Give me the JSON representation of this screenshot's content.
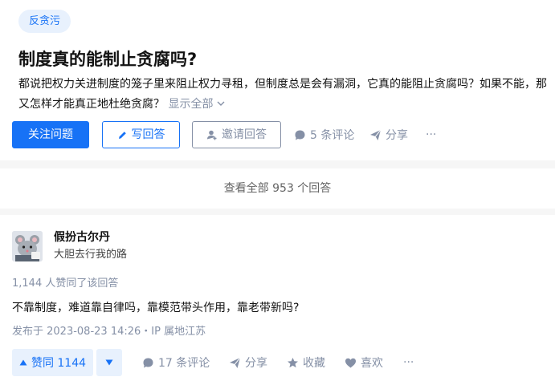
{
  "question": {
    "topic_tag": "反贪污",
    "title": "制度真的能制止贪腐吗?",
    "detail": "都说把权力关进制度的笼子里来阻止权力寻租，但制度总是会有漏洞，它真的能阻止贪腐吗？如果不能，那又怎样才能真正地杜绝贪腐？",
    "show_all": "显示全部",
    "actions": {
      "follow": "关注问题",
      "write_answer": "写回答",
      "invite": "邀请回答",
      "comments": "5 条评论",
      "share": "分享",
      "more": "···"
    }
  },
  "view_all_answers": "查看全部 953 个回答",
  "answer": {
    "author_name": "假扮古尔丹",
    "author_bio": "大胆去行我的路",
    "vote_summary": "1,144 人赞同了该回答",
    "content": "不靠制度，难道靠自律吗，靠模范带头作用，靠老带新吗?",
    "publish_info": "发布于 2023-08-23 14:26・IP 属地江苏",
    "actions": {
      "upvote": "赞同 1144",
      "comments": "17 条评论",
      "share": "分享",
      "favorite": "收藏",
      "like": "喜欢",
      "more": "···"
    }
  },
  "colors": {
    "accent": "#1772f6",
    "accent_light": "#e8f1fd",
    "meta_grey": "#8590a6",
    "page_bg": "#f6f6f6"
  }
}
